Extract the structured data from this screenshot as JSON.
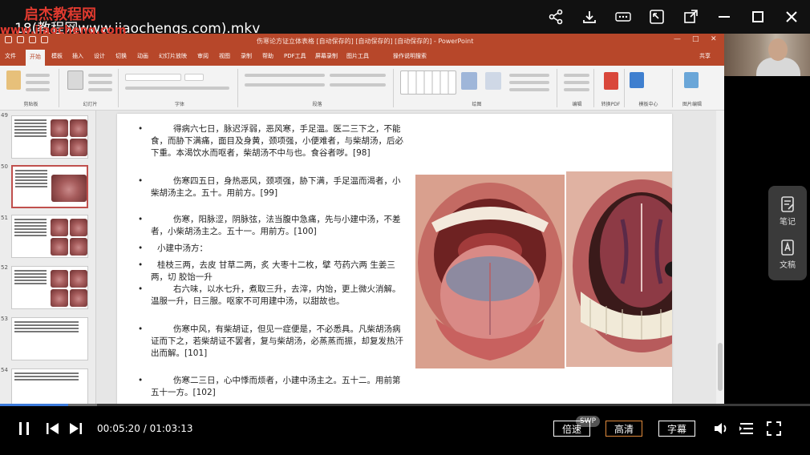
{
  "watermark": {
    "line1": "启杰教程网",
    "line2": "www.jiaocheng.com"
  },
  "header": {
    "title": "18(教程网www.jiaochengs.com).mkv"
  },
  "top_icons": [
    "share-icon",
    "download-icon",
    "pip-icon",
    "popout-icon",
    "minimize-icon",
    "maximize-icon",
    "close-icon"
  ],
  "ppt": {
    "window_title": "伤寒论方证立体表格 [自动保存的] [自动保存的] [自动保存的] - PowerPoint",
    "tabs": [
      "文件",
      "开始",
      "模板",
      "插入",
      "设计",
      "切换",
      "动画",
      "幻灯片放映",
      "审阅",
      "视图",
      "录制",
      "帮助",
      "PDF工具",
      "屏幕录制",
      "图片工具",
      "操作说明搜索"
    ],
    "active_tab": "开始",
    "share": "共享",
    "ribbon_groups": [
      "剪贴板",
      "幻灯片",
      "字体",
      "段落",
      "绘图",
      "编辑",
      "转换PDF",
      "模板中心",
      "图片编辑"
    ],
    "thumb_numbers": [
      "49",
      "50",
      "51",
      "52",
      "53",
      "54"
    ]
  },
  "slide": {
    "paragraphs": [
      {
        "bullet": "•",
        "text": "得病六七日，脉迟浮弱，恶风寒，手足温。医二三下之，不能食，而胁下满痛，面目及身黄，颈项强，小便难者，与柴胡汤，后必下重。本渴饮水而呕者，柴胡汤不中与也。食谷者哕。[98]"
      },
      {
        "bullet": "•",
        "text": "伤寒四五日，身热恶风，颈项强，胁下满，手足温而渴者，小柴胡汤主之。五十。用前方。[99]"
      },
      {
        "bullet": "•",
        "text": "伤寒，阳脉涩，阴脉弦，法当腹中急痛，先与小建中汤，不差者，小柴胡汤主之。五十一。用前方。[100]"
      },
      {
        "bullet": "•",
        "text": "小建中汤方："
      },
      {
        "bullet": "•",
        "text": "桂枝三两，去皮 甘草二两，炙 大枣十二枚，擘 芍药六两 生姜三两，切 胶饴一升"
      },
      {
        "bullet": "•",
        "text": "右六味，以水七升，煮取三升，去滓，内饴，更上微火消解。温服一升，日三服。呕家不可用建中汤，以甜故也。"
      },
      {
        "bullet": "•",
        "text": "伤寒中风，有柴胡证，但见一症便是，不必悉具。凡柴胡汤病证而下之，若柴胡证不罢者，复与柴胡汤，必蒸蒸而振，却复发热汗出而解。[101]"
      },
      {
        "bullet": "•",
        "text": "伤寒二三日，心中悸而烦者，小建中汤主之。五十二。用前第五十一方。[102]"
      }
    ]
  },
  "player": {
    "progress": 0.084,
    "buffered": 0.12,
    "current_time": "00:05:20",
    "separator": "/",
    "total_time": "01:03:13",
    "speed_label": "倍速",
    "swp_label": "SWP",
    "quality_label": "高清",
    "subtitle_label": "字幕"
  },
  "side_tools": {
    "notes": "笔记",
    "transcript": "文稿"
  },
  "colors": {
    "ppt_accent": "#b7472a",
    "progress": "#3d7bdc",
    "highlight": "#e08a3c"
  }
}
